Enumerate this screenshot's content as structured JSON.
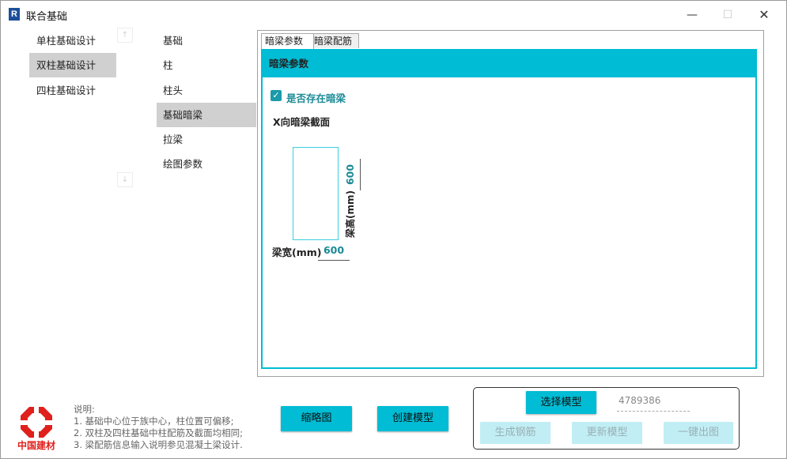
{
  "window": {
    "title": "联合基础",
    "icon_letter": "R",
    "controls": {
      "minimize": "—",
      "maximize": "☐",
      "close": "✕"
    }
  },
  "nav": {
    "items": [
      {
        "label": "单柱基础设计",
        "active": false
      },
      {
        "label": "双柱基础设计",
        "active": true
      },
      {
        "label": "四柱基础设计",
        "active": false
      }
    ],
    "scroll_up": "↑",
    "scroll_down": "↓"
  },
  "subnav": {
    "items": [
      {
        "label": "基础",
        "active": false
      },
      {
        "label": "柱",
        "active": false
      },
      {
        "label": "柱头",
        "active": false
      },
      {
        "label": "基础暗梁",
        "active": true
      },
      {
        "label": "拉梁",
        "active": false
      },
      {
        "label": "绘图参数",
        "active": false
      }
    ]
  },
  "tabs": [
    {
      "label": "暗梁参数",
      "selected": true
    },
    {
      "label": "暗梁配筋",
      "selected": false
    }
  ],
  "panel": {
    "header": "暗梁参数",
    "checkbox": {
      "label": "是否存在暗梁",
      "checked": true,
      "mark": "✓"
    },
    "section_label": "X向暗梁截面",
    "beam_height": {
      "label": "梁高(mm)",
      "value": "600"
    },
    "beam_width": {
      "label": "梁宽(mm)",
      "value": "600"
    }
  },
  "logo": {
    "text": "中国建材",
    "color": "#e0201c"
  },
  "notes": {
    "title": "说明:",
    "lines": [
      "1. 基础中心位于族中心，柱位置可偏移;",
      "2. 双柱及四柱基础中柱配筋及截面均相同;",
      "3. 梁配筋信息输入说明参见混凝土梁设计."
    ]
  },
  "buttons": {
    "thumbnail": "缩略图",
    "create_model": "创建模型",
    "select_model": "选择模型",
    "model_id": "4789386",
    "generate_rebar": "生成钢筋",
    "update_model": "更新模型",
    "export_drawing": "一键出图"
  },
  "colors": {
    "accent": "#00bcd4",
    "accent_disabled": "#c0eef4",
    "value_text": "#1a8a96"
  }
}
